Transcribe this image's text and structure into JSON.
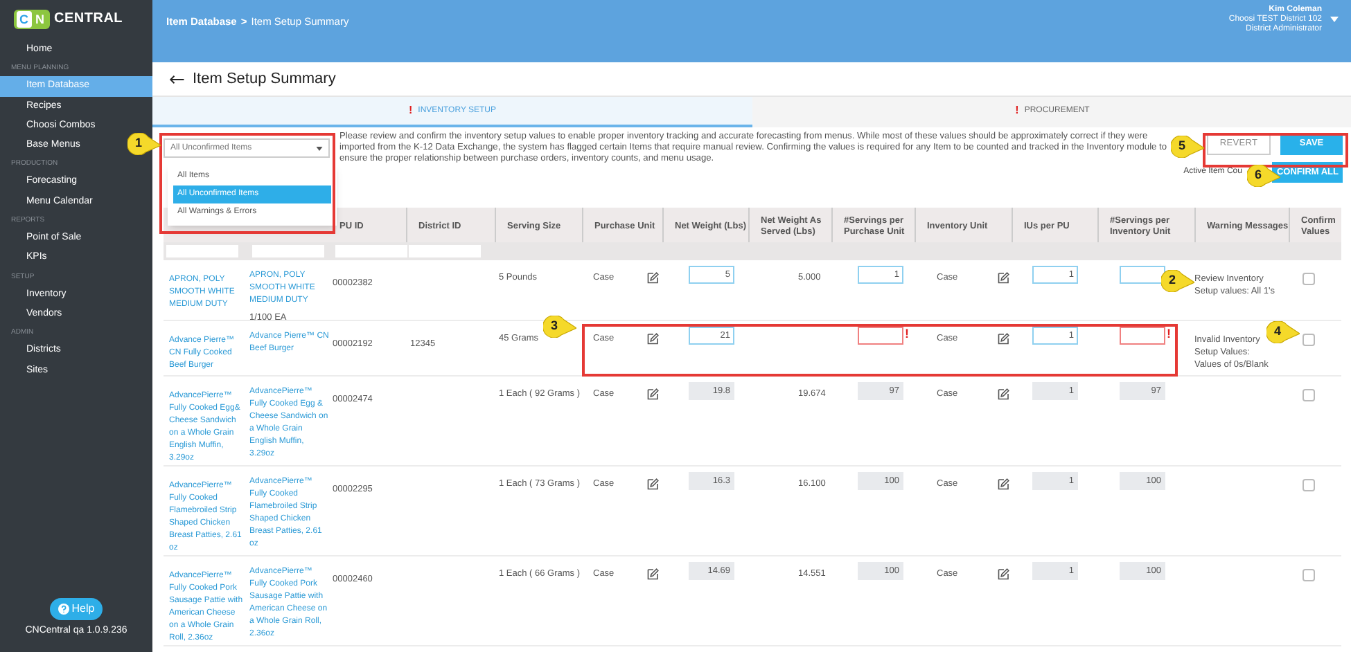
{
  "sidebar": {
    "logo": {
      "letters": [
        "C",
        "N"
      ],
      "text": "CENTRAL"
    },
    "sections": [
      {
        "items": [
          {
            "label": "Home",
            "selected": false
          }
        ]
      },
      {
        "heading": "MENU PLANNING",
        "items": [
          {
            "label": "Item Database",
            "selected": true
          },
          {
            "label": "Recipes",
            "selected": false
          },
          {
            "label": "Choosi Combos",
            "selected": false
          },
          {
            "label": "Base Menus",
            "selected": false
          }
        ]
      },
      {
        "heading": "PRODUCTION",
        "items": [
          {
            "label": "Forecasting",
            "selected": false
          },
          {
            "label": "Menu Calendar",
            "selected": false
          }
        ]
      },
      {
        "heading": "REPORTS",
        "items": [
          {
            "label": "Point of Sale",
            "selected": false
          },
          {
            "label": "KPIs",
            "selected": false
          }
        ]
      },
      {
        "heading": "SETUP",
        "items": [
          {
            "label": "Inventory",
            "selected": false
          },
          {
            "label": "Vendors",
            "selected": false
          }
        ]
      },
      {
        "heading": "ADMIN",
        "items": [
          {
            "label": "Districts",
            "selected": false
          },
          {
            "label": "Sites",
            "selected": false
          }
        ]
      }
    ],
    "help": "Help",
    "version": "CNCentral qa 1.0.9.236"
  },
  "header": {
    "breadcrumb": [
      {
        "label": "Item Database"
      },
      {
        "label": "Item Setup Summary"
      }
    ],
    "separator": ">",
    "user": {
      "name": "Kim Coleman",
      "district": "Choosi TEST District 102",
      "role": "District Administrator"
    }
  },
  "page_title": "Item Setup Summary",
  "tabs": [
    {
      "label": "INVENTORY SETUP",
      "alert": "!",
      "selected": true
    },
    {
      "label": "PROCUREMENT",
      "alert": "!",
      "selected": false
    }
  ],
  "filter": {
    "value": "All Unconfirmed Items",
    "expanded": true,
    "options": [
      {
        "label": "All Items",
        "selected": false
      },
      {
        "label": "All Unconfirmed Items",
        "selected": true
      },
      {
        "label": "All Warnings & Errors",
        "selected": false
      }
    ]
  },
  "instructions": "Please review and confirm the inventory setup values to enable proper inventory tracking and accurate forecasting from menus. While most of these values should be approximately correct if they were imported from the K-12 Data Exchange, the system has flagged certain Items that require manual review. Confirming the values is required for any Item to be counted and tracked in the Inventory module to ensure the proper relationship between purchase orders, inventory counts, and menu usage.",
  "buttons": {
    "revert": "REVERT",
    "save": "SAVE",
    "confirm_all": "CONFIRM ALL"
  },
  "active_item_count": "Active Item Cou",
  "table": {
    "columns": [
      "PU ID",
      "District ID",
      "Serving Size",
      "Purchase Unit",
      "Net Weight (Lbs)",
      "Net Weight As Served (Lbs)",
      "#Servings per Purchase Unit",
      "Inventory Unit",
      "IUs per PU",
      "#Servings per Inventory Unit",
      "Warning Messages",
      "Confirm Values"
    ],
    "rows": [
      {
        "name": "APRON, POLY SMOOTH WHITE MEDIUM DUTY",
        "description": "APRON, POLY SMOOTH WHITE MEDIUM DUTY",
        "pack": "1/100 EA",
        "pu_id": "00002382",
        "serving_size": "5 Pounds",
        "purchase_unit": "Case",
        "net_weight": {
          "kind": "editable",
          "value": "5"
        },
        "net_weight_served": "5.000",
        "servings_per_pu": {
          "kind": "editable",
          "value": "1"
        },
        "inventory_unit": "Case",
        "ius_per_pu": {
          "kind": "editable",
          "value": "1"
        },
        "servings_per_iu": {
          "kind": "editable"
        },
        "warning": "Review Inventory Setup values: All 1's",
        "confirmed": false
      },
      {
        "name": "Advance Pierre™ CN Fully Cooked Beef Burger",
        "description": "Advance Pierre™ CN Beef Burger",
        "pu_id": "00002192",
        "district_id": "12345",
        "serving_size": "45 Grams",
        "purchase_unit": "Case",
        "net_weight": {
          "kind": "editable",
          "value": "21"
        },
        "servings_per_pu": {
          "kind": "error",
          "alert": "!"
        },
        "inventory_unit": "Case",
        "ius_per_pu": {
          "kind": "editable",
          "value": "1"
        },
        "servings_per_iu": {
          "kind": "error",
          "alert": "!"
        },
        "warning": "Invalid Inventory Setup Values: Values of 0s/Blank",
        "confirmed": false
      },
      {
        "name": "AdvancePierre™ Fully Cooked Egg& Cheese Sandwich on a Whole Grain English Muffin, 3.29oz",
        "description": "AdvancePierre™ Fully Cooked Egg & Cheese Sandwich on a Whole Grain English Muffin, 3.29oz",
        "pu_id": "00002474",
        "serving_size": "1 Each ( 92 Grams )",
        "purchase_unit": "Case",
        "net_weight": {
          "kind": "readonly",
          "value": "19.8"
        },
        "net_weight_served": "19.674",
        "servings_per_pu": {
          "kind": "readonly",
          "value": "97"
        },
        "inventory_unit": "Case",
        "ius_per_pu": {
          "kind": "readonly",
          "value": "1"
        },
        "servings_per_iu": {
          "kind": "readonly",
          "value": "97"
        },
        "confirmed": false
      },
      {
        "name": "AdvancePierre™ Fully Cooked Flamebroiled Strip Shaped Chicken Breast Patties, 2.61 oz",
        "description": "AdvancePierre™ Fully Cooked Flamebroiled Strip Shaped Chicken Breast Patties, 2.61 oz",
        "pu_id": "00002295",
        "serving_size": "1 Each ( 73 Grams )",
        "purchase_unit": "Case",
        "net_weight": {
          "kind": "readonly",
          "value": "16.3"
        },
        "net_weight_served": "16.100",
        "servings_per_pu": {
          "kind": "readonly",
          "value": "100"
        },
        "inventory_unit": "Case",
        "ius_per_pu": {
          "kind": "readonly",
          "value": "1"
        },
        "servings_per_iu": {
          "kind": "readonly",
          "value": "100"
        },
        "confirmed": false
      },
      {
        "name": "AdvancePierre™ Fully Cooked Pork Sausage Pattie with American Cheese on a Whole Grain Roll, 2.36oz",
        "description": "AdvancePierre™ Fully Cooked Pork Sausage Pattie with American Cheese on a Whole Grain Roll, 2.36oz",
        "pu_id": "00002460",
        "serving_size": "1 Each ( 66 Grams )",
        "purchase_unit": "Case",
        "net_weight": {
          "kind": "readonly",
          "value": "14.69"
        },
        "net_weight_served": "14.551",
        "servings_per_pu": {
          "kind": "readonly",
          "value": "100"
        },
        "inventory_unit": "Case",
        "ius_per_pu": {
          "kind": "readonly",
          "value": "1"
        },
        "servings_per_iu": {
          "kind": "readonly",
          "value": "100"
        },
        "confirmed": false
      }
    ]
  },
  "callouts": [
    {
      "number": "1"
    },
    {
      "number": "2"
    },
    {
      "number": "3"
    },
    {
      "number": "4"
    },
    {
      "number": "5"
    },
    {
      "number": "6"
    }
  ]
}
